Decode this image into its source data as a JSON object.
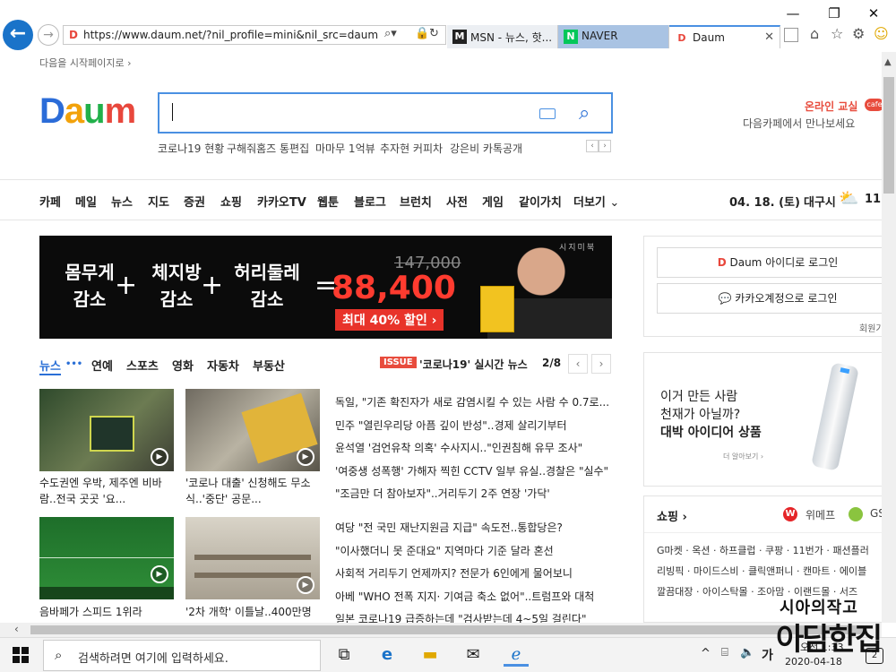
{
  "browser": {
    "url": "https://www.daum.net/?nil_profile=mini&nil_src=daum",
    "tabs": [
      {
        "label": "MSN - 뉴스, 핫..."
      },
      {
        "label": "NAVER"
      },
      {
        "label": "Daum"
      }
    ],
    "window_controls": {
      "minimize": "—",
      "maximize": "❐",
      "close": "✕"
    }
  },
  "header": {
    "start_page_link": "다음을 시작페이지로 ›",
    "logo": [
      "D",
      "a",
      "u",
      "m"
    ],
    "logo_colors": [
      "#2b6cd8",
      "#f2a20b",
      "#21b04a",
      "#e8473c"
    ],
    "keywords": [
      "코로나19 현황",
      "구해줘홈즈 통편집",
      "마마무 1억뷰",
      "추자현 커피차",
      "강은비 카톡공개"
    ],
    "promo_title": "온라인 교실",
    "promo_subtitle": "다음카페에서 만나보세요",
    "promo_badge": "cafe"
  },
  "gnb": {
    "items": [
      "카페",
      "메일",
      "뉴스",
      "지도",
      "증권",
      "쇼핑",
      "카카오TV",
      "웹툰",
      "블로그",
      "브런치",
      "사전",
      "게임",
      "같이가치",
      "더보기"
    ],
    "date": "04. 18. (토)",
    "city": "대구시",
    "temp": "11"
  },
  "banner": {
    "word1": [
      "몸무게",
      "감소"
    ],
    "word2": [
      "체지방",
      "감소"
    ],
    "word3": [
      "허리둘레",
      "감소"
    ],
    "old_price": "147,000",
    "price": "88,400",
    "discount": "최대 40% 할인 ›",
    "brand": "시지미북"
  },
  "news": {
    "tabs": [
      "뉴스",
      "연예",
      "스포츠",
      "영화",
      "자동차",
      "부동산"
    ],
    "issue_badge": "ISSUE",
    "issue_title": "'코로나19' 실시간 뉴스",
    "issue_page": "2/8",
    "cards": [
      {
        "caption": "수도권엔 우박, 제주엔 비바람..전국 곳곳 '요..."
      },
      {
        "caption": "'코로나 대출' 신청해도 무소식..'중단' 공문..."
      },
      {
        "caption": "음바페가 스피드 1위라"
      },
      {
        "caption": "'2차 개학' 이틀날..400만명"
      }
    ],
    "headlines": [
      "독일, \"기존 확진자가 새로 감염시킬 수 있는 사람 수 0.7로...",
      "민주 \"열린우리당 아픔 깊이 반성\"..경제 살리기부터",
      "윤석열 '검언유착 의혹' 수사지시..\"인권침해 유무 조사\"",
      "'여중생 성폭행' 가해자 찍힌 CCTV 일부 유실..경찰은 \"실수\"",
      "\"조금만 더 참아보자\"..거리두기 2주 연장 '가닥'",
      "여당 \"전 국민 재난지원금 지급\" 속도전..통합당은?",
      "\"이사했더니 못 준대요\" 지역마다 기준 달라 혼선",
      "사회적 거리두기 언제까지? 전문가 6인에게 물어보니",
      "아베 \"WHO 전폭 지지· 기여금 축소 없어\"..트럼프와 대척",
      "일본 코로나19 급증하는데 \"검사받는데 4~5일 걸린다\""
    ]
  },
  "login": {
    "daum_login": "Daum 아이디로 로그인",
    "kakao_login": "카카오계정으로 로그인",
    "join": "회원가"
  },
  "ad": {
    "line1": "이거 만든 사람",
    "line2": "천재가 아닐까?",
    "line3": "대박 아이디어 상품",
    "more": "더 알아보기 ›"
  },
  "shopping": {
    "title": "쇼핑 ›",
    "partner1": "위메프",
    "partner2": "GS",
    "lines": [
      "G마켓 · 옥션 · 하프클럽 · 쿠팡 · 11번가 · 패션플러",
      "리빙픽 · 마이드스비 · 클릭앤퍼니 · 캔마트 · 에이블",
      "깔끔대장 · 아이스탁몰 · 조아맘 · 이랜드몰 · 서즈"
    ]
  },
  "taskbar": {
    "search_placeholder": "검색하려면 여기에 입력하세요.",
    "ime": "가",
    "time": "오전 1:33",
    "date": "2020-04-18",
    "notifications": "2"
  },
  "watermark": {
    "top": "시아의작고",
    "bottom": "아담한집"
  }
}
